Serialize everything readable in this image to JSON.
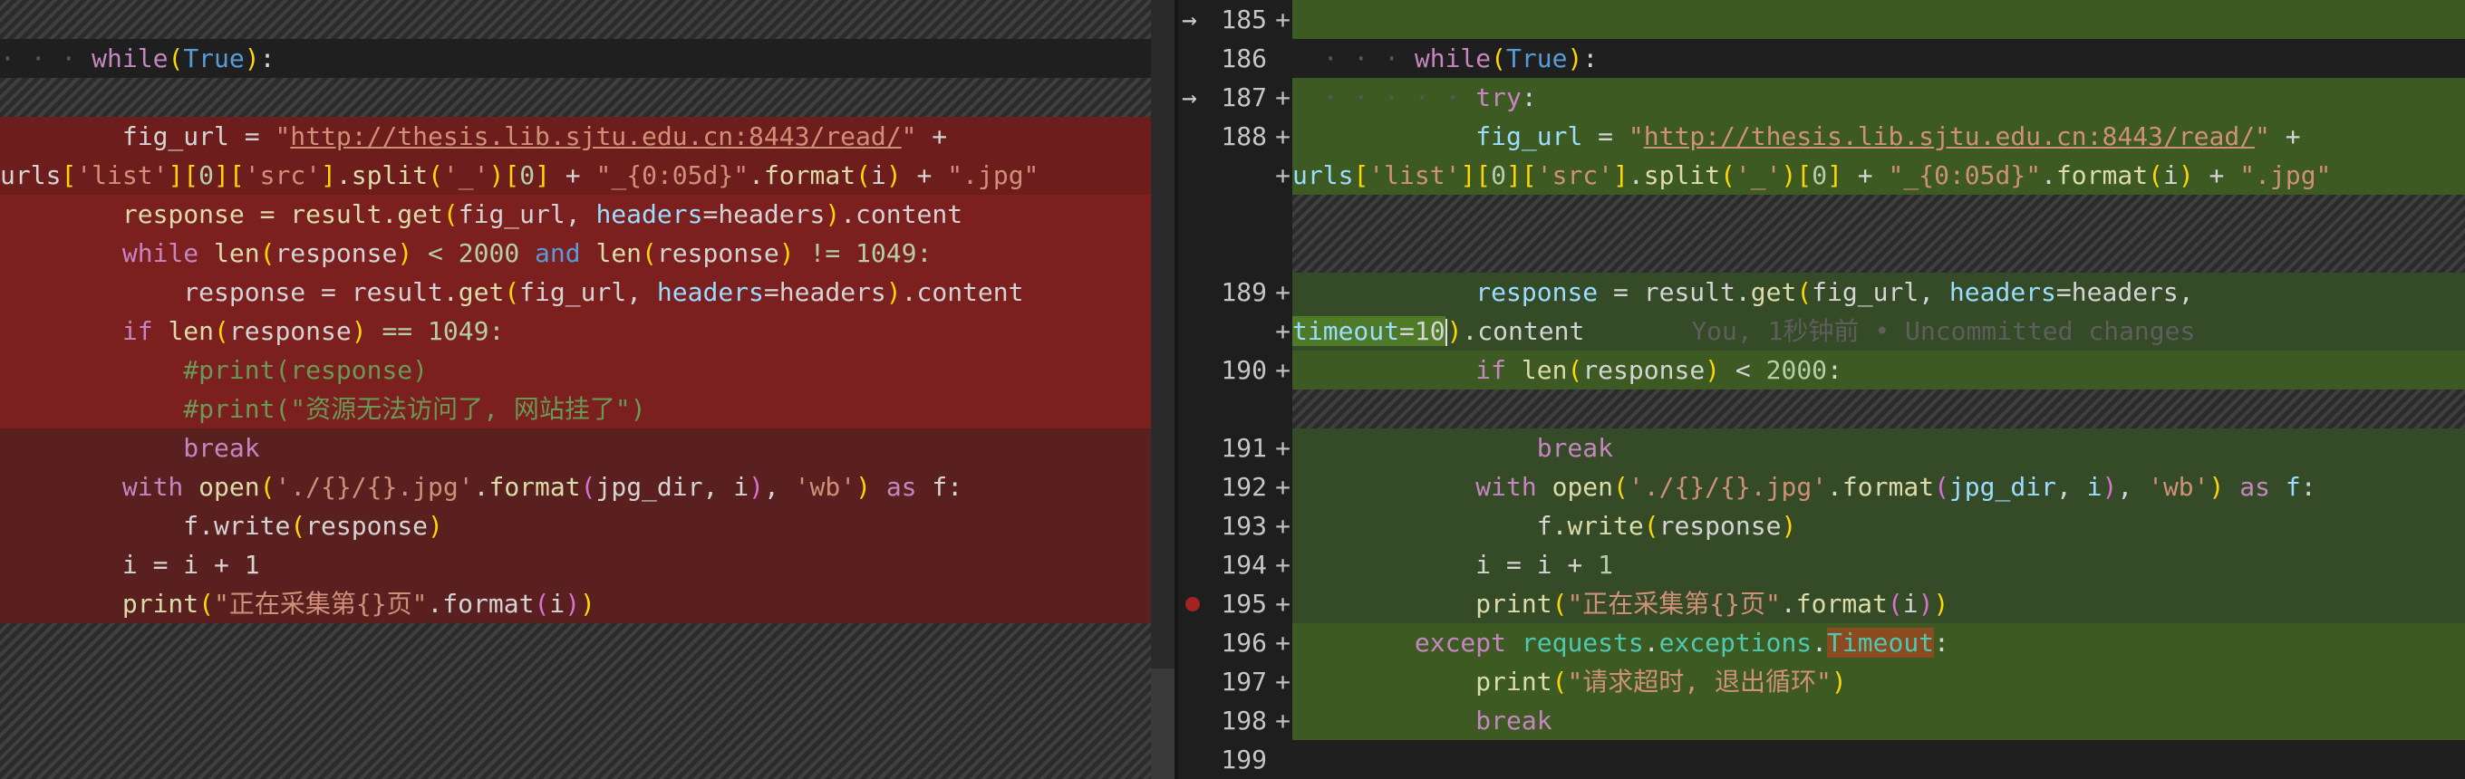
{
  "left": {
    "line_01": "while",
    "line_01b": "True",
    "fig_url_prefix": "fig_url = ",
    "url": "http://thesis.lib.sjtu.edu.cn:8443/read/",
    "url_cont_a": "urls",
    "url_cont_b": "'list'",
    "url_cont_c": "0",
    "url_cont_d": "'src'",
    "url_cont_e": "split",
    "url_cont_f": "'_'",
    "url_cont_g": "\"_{0:05d}\"",
    "url_cont_h": "format",
    "url_cont_i": "\".jpg\"",
    "resp_get": "response = result.get",
    "headers_kw": "headers",
    "headers_val": "=headers",
    "content": ".content",
    "while_len": "while",
    "len1": "len",
    "resp_word": "response",
    "lt2000": " < 2000 ",
    "and_kw": "and",
    "len2": "len",
    "ne1049": " != 1049:",
    "if_kw": "if",
    "eq1049": " == 1049:",
    "comment1": "#print(response)",
    "comment2": "#print(\"资源无法访问了, 网站挂了\")",
    "break_kw": "break",
    "with_kw": "with",
    "open_fn": "open",
    "path_str": "'./{}/{}.jpg'",
    "jpg_dir": "jpg_dir",
    "i_var": "i",
    "wb_str": "'wb'",
    "as_kw": "as",
    "f_var": "f:",
    "fwrite": "f.write",
    "i_inc": "i = i + 1",
    "print_fn": "print",
    "print_str": "\"正在采集第{}页\"",
    "print_fmt": ".format"
  },
  "gutter": {
    "lines": [
      {
        "num": "185",
        "mark": "+",
        "arrow": "→"
      },
      {
        "num": "186",
        "mark": "",
        "arrow": ""
      },
      {
        "num": "187",
        "mark": "+",
        "arrow": "→"
      },
      {
        "num": "188",
        "mark": "+",
        "arrow": ""
      },
      {
        "num": "",
        "mark": "+",
        "arrow": ""
      },
      {
        "num": "189",
        "mark": "+",
        "arrow": ""
      },
      {
        "num": "",
        "mark": "+",
        "arrow": ""
      },
      {
        "num": "190",
        "mark": "+",
        "arrow": ""
      },
      {
        "num": "191",
        "mark": "+",
        "arrow": ""
      },
      {
        "num": "192",
        "mark": "+",
        "arrow": ""
      },
      {
        "num": "193",
        "mark": "+",
        "arrow": ""
      },
      {
        "num": "194",
        "mark": "+",
        "arrow": ""
      },
      {
        "num": "195",
        "mark": "+",
        "arrow": ""
      },
      {
        "num": "196",
        "mark": "+",
        "arrow": ""
      },
      {
        "num": "197",
        "mark": "+",
        "arrow": ""
      },
      {
        "num": "198",
        "mark": "+",
        "arrow": ""
      },
      {
        "num": "199",
        "mark": "",
        "arrow": ""
      }
    ]
  },
  "right": {
    "try_kw": "try",
    "timeout_kw": "timeout",
    "timeout_val": "=10",
    "blame": "You, 1秒钟前 • Uncommitted changes",
    "except_kw": "except",
    "requests": "requests",
    "exceptions": "exceptions",
    "Timeout": "Timeout",
    "timeout_msg": "\"请求超时, 退出循环\""
  },
  "colors": {
    "deleted": "#6e1d1d",
    "added": "#3d5a23",
    "keyword": "#c586c0",
    "string": "#ce9178"
  }
}
